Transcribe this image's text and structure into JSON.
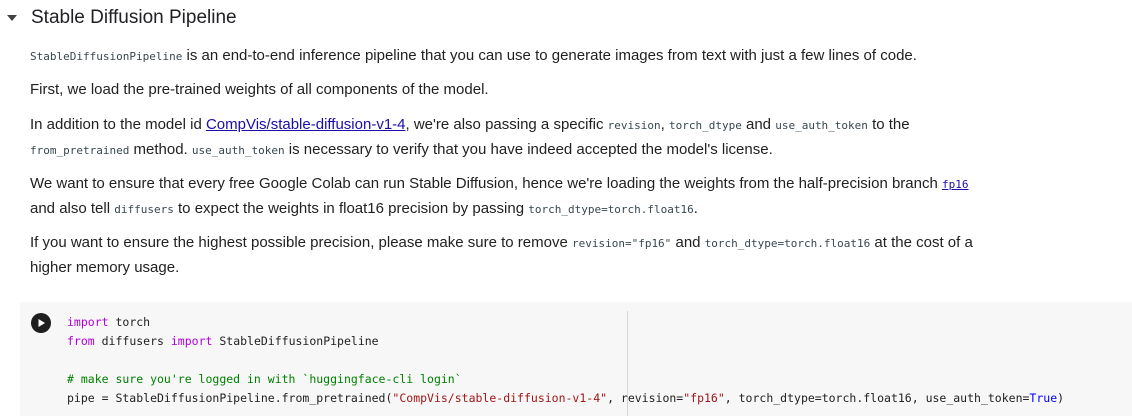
{
  "section": {
    "title": "Stable Diffusion Pipeline"
  },
  "p1": {
    "code": "StableDiffusionPipeline",
    "text": " is an end-to-end inference pipeline that you can use to generate images from text with just a few lines of code."
  },
  "p2": {
    "text": "First, we load the pre-trained weights of all components of the model."
  },
  "p3": {
    "t1": "In addition to the model id ",
    "link": "CompVis/stable-diffusion-v1-4",
    "t2": ", we're also passing a specific ",
    "c1": "revision",
    "t3": ", ",
    "c2": "torch_dtype",
    "t4": " and ",
    "c3": "use_auth_token",
    "t5": " to the",
    "c4": "from_pretrained",
    "t6": " method. ",
    "c5": "use_auth_token",
    "t7": " is necessary to verify that you have indeed accepted the model's license."
  },
  "p4": {
    "t1": "We want to ensure that every free Google Colab can run Stable Diffusion, hence we're loading the weights from the half-precision branch ",
    "link": "fp16",
    "t2": "and also tell ",
    "c1": "diffusers",
    "t3": " to expect the weights in float16 precision by passing ",
    "c2": "torch_dtype=torch.float16",
    "t4": "."
  },
  "p5": {
    "t1": "If you want to ensure the highest possible precision, please make sure to remove ",
    "c1": "revision=\"fp16\"",
    "t2": " and ",
    "c2": "torch_dtype=torch.float16",
    "t3": " at the cost of a",
    "t4": "higher memory usage."
  },
  "cell": {
    "line1": {
      "kw": "import",
      "rest": " torch"
    },
    "line2": {
      "kw1": "from",
      "mid": " diffusers ",
      "kw2": "import",
      "rest": " StableDiffusionPipeline"
    },
    "line4": {
      "comment": "# make sure you're logged in with `huggingface-cli login`"
    },
    "line5": {
      "a": "pipe = StableDiffusionPipeline.from_pretrained(",
      "s1": "\"CompVis/stable-diffusion-v1-4\"",
      "b": ", revision=",
      "s2": "\"fp16\"",
      "c": ", torch_dtype=torch.float16, use_auth_token=",
      "kv": "True",
      "d": ")"
    }
  },
  "icons": {
    "collapse": "caret-down-icon",
    "run": "play-icon"
  },
  "colors": {
    "link": "#1a0dab",
    "keyword": "#af00db",
    "comment": "#008000",
    "string": "#a31515",
    "cell_bg": "#f7f7f7"
  }
}
